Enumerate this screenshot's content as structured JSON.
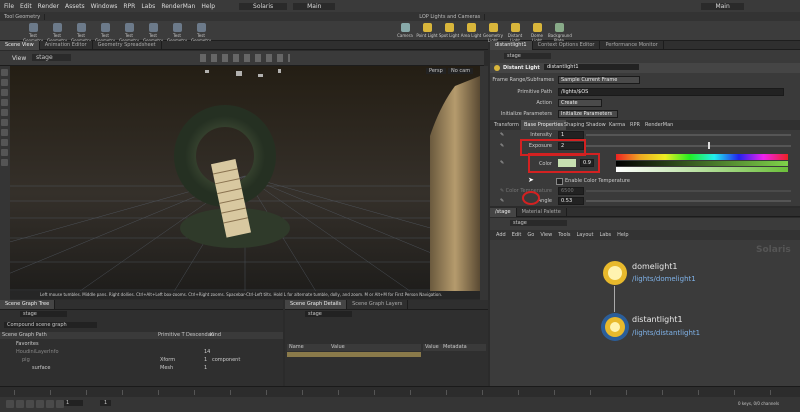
{
  "menubar": {
    "items": [
      "File",
      "Edit",
      "Render",
      "Assets",
      "Windows",
      "RPR",
      "Labs",
      "RenderMan",
      "Help"
    ],
    "desktop": "Solaris",
    "main": "Main",
    "right_desktop": "Main"
  },
  "shelf_tabs": [
    "Tool Geometry"
  ],
  "shelf_left_tools": [
    "Test Geometry 1",
    "Test Geometry 2",
    "Test Geometry 3",
    "Test Geometry 4",
    "Test Geometry 5",
    "Test Geometry 6",
    "Test Geometry 7",
    "Test Geometry 8"
  ],
  "shelf_right_tools": [
    "Camera",
    "Point Light",
    "Spot Light",
    "Area Light",
    "Geometry Light",
    "Distant Light",
    "Dome Light",
    "Background Plate"
  ],
  "shelf_right_tab": "LOP Lights and Cameras",
  "left_pane_tabs": [
    "Scene View",
    "Animation Editor",
    "Geometry Spreadsheet"
  ],
  "right_pane_tabs": [
    "distantlight1",
    "Context Options Editor",
    "Performance Monitor"
  ],
  "viewport": {
    "title": "View",
    "context": "stage",
    "persp": "Persp",
    "cam": "No cam"
  },
  "status_text": "Left mouse tumbles. Middle pans. Right dollies. Ctrl+Alt+Left box-zooms. Ctrl+Right zooms. Spacebar-Ctrl-Left tilts. Hold L for alternate tumble, dolly, and zoom.    M or Alt+M for First Person Navigation.",
  "params": {
    "node_label": "Distant Light",
    "node_name": "distantlight1",
    "frame_range_label": "Frame Range/Subframes",
    "frame_range_value": "Sample Current Frame",
    "prim_path_label": "Primitive Path",
    "prim_path_value": "/lights/$OS",
    "action_label": "Action",
    "action_value": "Create",
    "init_label": "Initialize Parameters",
    "init_value": "Initialize Parameters",
    "tabs": [
      "Transform",
      "Base Properties",
      "Shaping",
      "Shadow",
      "Karma",
      "RPR",
      "RenderMan"
    ],
    "intensity_label": "Intensity",
    "intensity_value": "1",
    "exposure_label": "Exposure",
    "exposure_value": "2",
    "color_label": "Color",
    "color_value": "0.9",
    "enable_color_temp": "Enable Color Temperature",
    "color_temp_label": "Color Temperature",
    "color_temp_value": "6500",
    "angle_label": "Angle",
    "angle_value": "0.53"
  },
  "net_tabs": [
    "/stage",
    "Material Palette"
  ],
  "net_path": "stage",
  "net_menu": [
    "Add",
    "Edit",
    "Go",
    "View",
    "Tools",
    "Layout",
    "Labs",
    "Help"
  ],
  "net_context": "Solaris",
  "nodes": [
    {
      "name": "domelight1",
      "path": "/lights/domelight1"
    },
    {
      "name": "distantlight1",
      "path": "/lights/distantlight1"
    }
  ],
  "scene_graph": {
    "tabs": [
      "Scene Graph Tree"
    ],
    "path": "stage",
    "collection": "Compound scene graph",
    "columns": [
      "Scene Graph Path",
      "Primitive T",
      "Descendan",
      "Kind"
    ],
    "rows": [
      {
        "path": "Favorites",
        "type": "",
        "desc": "",
        "kind": ""
      },
      {
        "path": "HoudiniLayerInfo",
        "type": "",
        "desc": "14",
        "kind": ""
      },
      {
        "path": "pig",
        "type": "Xform",
        "desc": "1",
        "kind": "component"
      },
      {
        "path": "surface",
        "type": "Mesh",
        "desc": "1",
        "kind": ""
      }
    ]
  },
  "details": {
    "tabs": [
      "Scene Graph Details",
      "Scene Graph Layers"
    ],
    "path": "stage",
    "columns": [
      "Name",
      "Value"
    ],
    "side": [
      "Value",
      "Metadata"
    ]
  },
  "playbar": {
    "frame": "1",
    "start": "1",
    "end": "1",
    "status": "0 keys, 0/0 channels"
  }
}
